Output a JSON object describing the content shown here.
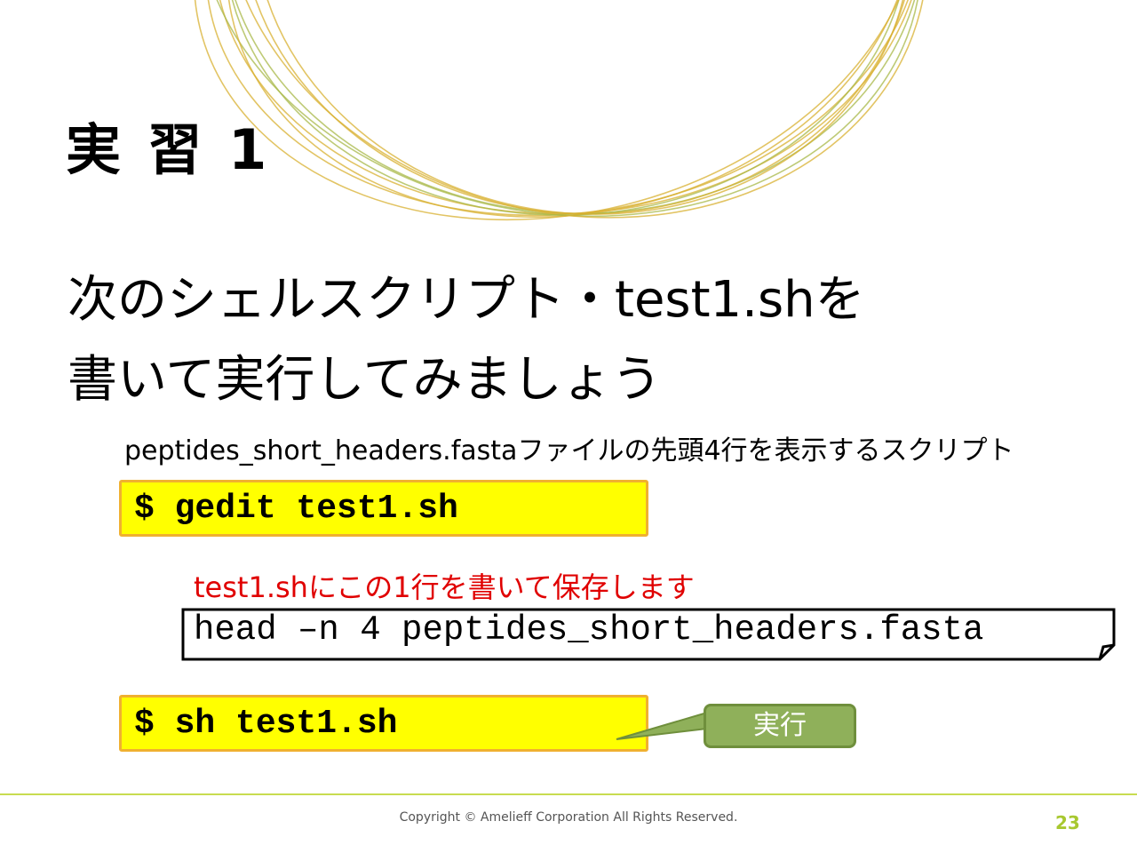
{
  "slide": {
    "title": "実 習 1",
    "heading_line1": "次のシェルスクリプト・test1.shを",
    "heading_line2": "書いて実行してみましょう",
    "description": "peptides_short_headers.fastaファイルの先頭4行を表示するスクリプト",
    "command1": "$ gedit test1.sh",
    "note": "test1.shにこの1行を書いて保存します",
    "code": "head –n 4 peptides_short_headers.fasta",
    "command2": "$ sh test1.sh",
    "callout": "実行"
  },
  "footer": {
    "copyright": "Copyright © Amelieff Corporation All Rights Reserved.",
    "page_number": "23"
  },
  "colors": {
    "command_bg": "#ffff00",
    "command_border": "#f0b030",
    "note_text": "#e00000",
    "callout_bg": "#8fb05a",
    "footer_line": "#c8dc50",
    "page_number": "#a8c830",
    "ring_gold": "#d8b030",
    "ring_green": "#a8b848"
  }
}
